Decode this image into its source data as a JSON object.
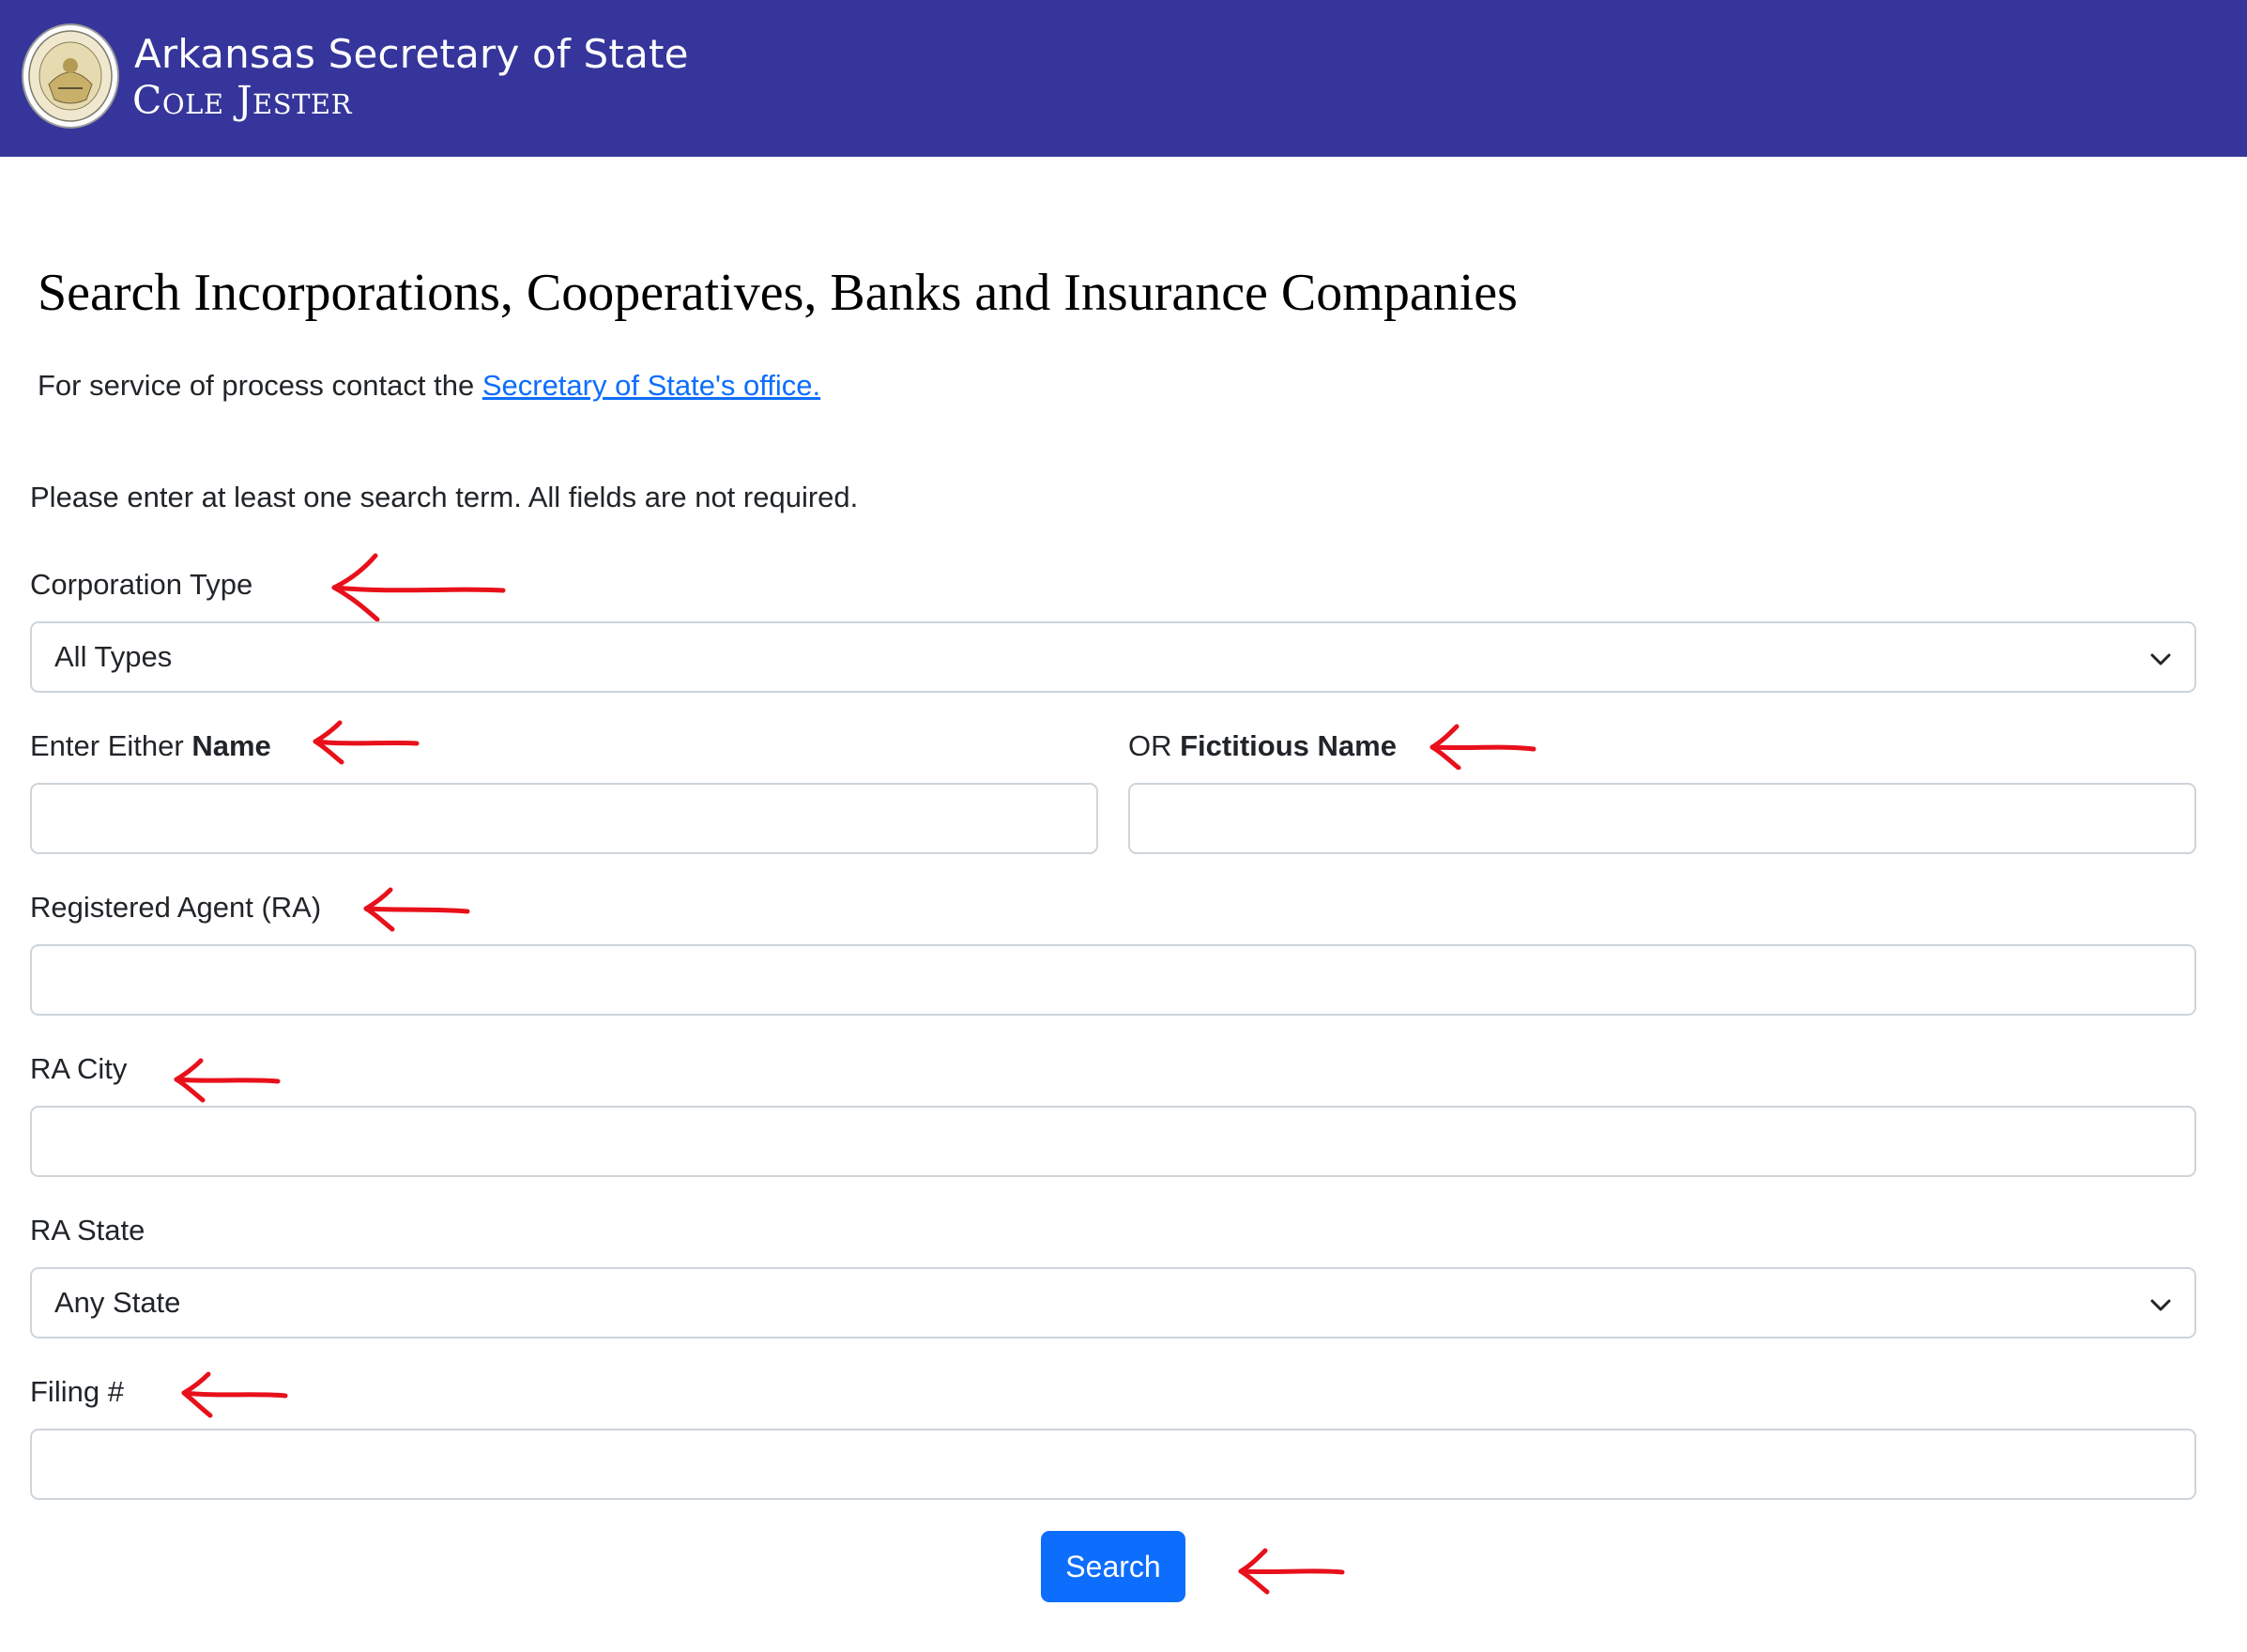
{
  "header": {
    "title_line1": "Arkansas Secretary of State",
    "title_line2": "Cole Jester",
    "background_color": "#35359b",
    "seal_icon": "state-seal-icon"
  },
  "page": {
    "title": "Search Incorporations, Cooperatives, Banks and Insurance Companies",
    "service_text": "For service of process contact the",
    "service_link": "Secretary of State's office.",
    "instructions": "Please enter at least one search term. All fields are not required."
  },
  "form": {
    "corporation_type": {
      "label": "Corporation Type",
      "value": "All Types"
    },
    "name": {
      "label_prefix": "Enter Either",
      "label_bold": "Name",
      "value": ""
    },
    "fictitious_name": {
      "label_prefix": "OR",
      "label_bold": "Fictitious Name",
      "value": ""
    },
    "registered_agent": {
      "label": "Registered Agent (RA)",
      "value": ""
    },
    "ra_city": {
      "label": "RA City",
      "value": ""
    },
    "ra_state": {
      "label": "RA State",
      "value": "Any State"
    },
    "filing_number": {
      "label": "Filing #",
      "value": ""
    },
    "search_button": "Search"
  },
  "annotations": {
    "arrow_color": "#e8101a",
    "arrow_icon": "red-left-arrow-icon"
  },
  "colors": {
    "primary": "#0d6efd",
    "border": "#ced4da",
    "text": "#212529"
  }
}
